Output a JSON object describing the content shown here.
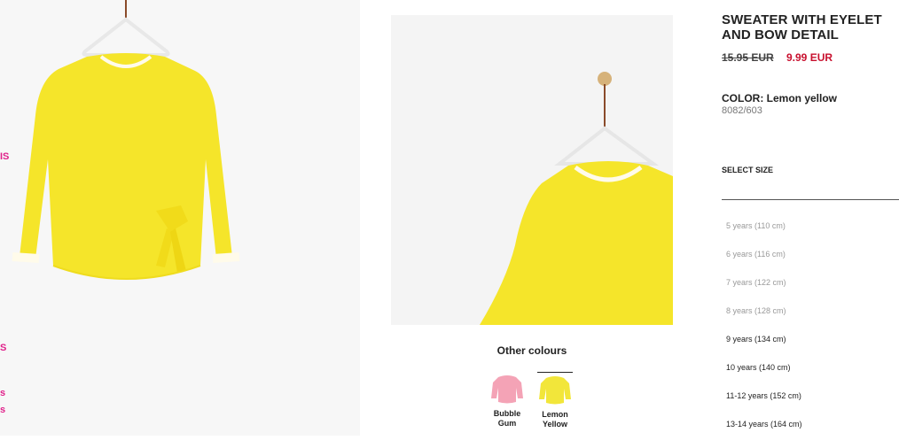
{
  "left_fragments": [
    "IS",
    "S",
    "s",
    "s"
  ],
  "product": {
    "title": "SWEATER WITH EYELET AND BOW DETAIL",
    "price_old": "15.95 EUR",
    "price_new": "9.99 EUR",
    "color_label": "COLOR: Lemon yellow",
    "reference": "8082/603"
  },
  "sizes": {
    "label": "SELECT SIZE",
    "items": [
      {
        "label": "5 years (110 cm)",
        "available": false
      },
      {
        "label": "6 years (116 cm)",
        "available": false
      },
      {
        "label": "7 years (122 cm)",
        "available": false
      },
      {
        "label": "8 years (128 cm)",
        "available": false
      },
      {
        "label": "9 years (134 cm)",
        "available": true
      },
      {
        "label": "10 years (140 cm)",
        "available": true
      },
      {
        "label": "11-12 years (152 cm)",
        "available": true
      },
      {
        "label": "13-14 years (164 cm)",
        "available": true
      }
    ]
  },
  "other_colours": {
    "title": "Other colours",
    "items": [
      {
        "label": "Bubble Gum",
        "color": "#f4a3b6",
        "selected": false
      },
      {
        "label": "Lemon Yellow",
        "color": "#f2e63a",
        "selected": true
      }
    ]
  },
  "colors": {
    "sale_price": "#c8102e",
    "sweater_yellow": "#f5e52a",
    "fragment_pink": "#e0218a"
  }
}
